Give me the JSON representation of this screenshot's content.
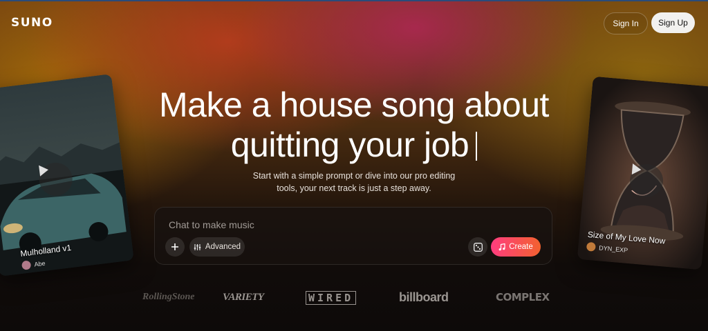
{
  "header": {
    "logo": "SUNO",
    "sign_in": "Sign In",
    "sign_up": "Sign Up"
  },
  "hero": {
    "line1": "Make a house song about",
    "line2": "quitting your job",
    "subtitle_line1": "Start with a simple prompt or dive into our pro editing",
    "subtitle_line2": "tools, your next track is just a step away."
  },
  "chat": {
    "placeholder": "Chat to make music",
    "value": "",
    "add_icon": "plus-icon",
    "advanced_label": "Advanced",
    "advanced_icon": "sliders-icon",
    "random_icon": "dice-icon",
    "create_label": "Create",
    "create_icon": "music-note-icon"
  },
  "cards": [
    {
      "title": "Mulholland v1",
      "author": "Abe"
    },
    {
      "title": "Size of My Love Now",
      "author": "DYN_EXP"
    }
  ],
  "press_logos": [
    "RollingStone",
    "VARIETY",
    "WIRED",
    "billboard",
    "COMPLEX"
  ],
  "colors": {
    "create_gradient_start": "#ff3d7f",
    "create_gradient_end": "#f2612f",
    "signup_bg": "#f2f1ef"
  }
}
